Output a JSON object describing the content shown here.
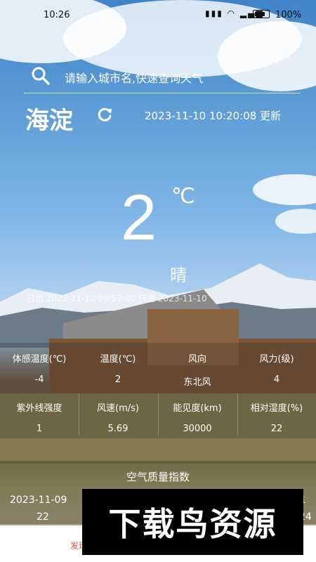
{
  "status_bar": {
    "time": "10:26",
    "battery_percent": "100%",
    "network": "4G"
  },
  "search": {
    "placeholder": "请输入城市名,快速查询天气"
  },
  "location": {
    "city": "海淀",
    "updated": "2023-11-10 10:20:08 更新"
  },
  "current": {
    "temperature": "2",
    "unit": "℃",
    "condition": "晴"
  },
  "sun": {
    "text": "日出 2023-11-10 06:57:00   日落 2023-11-10"
  },
  "details_row1": [
    {
      "label": "体感温度(℃)",
      "value": "-4"
    },
    {
      "label": "温度(℃)",
      "value": "2"
    },
    {
      "label": "风向",
      "value": "东北风"
    },
    {
      "label": "风力(级)",
      "value": "4"
    }
  ],
  "details_row2": [
    {
      "label": "紫外线强度",
      "value": "1"
    },
    {
      "label": "风速(m/s)",
      "value": "5.69"
    },
    {
      "label": "能见度(km)",
      "value": "30000"
    },
    {
      "label": "相对湿度(%)",
      "value": "22"
    }
  ],
  "air_quality": {
    "title": "空气质量指数",
    "first": {
      "date": "2023-11-09",
      "value": "22"
    },
    "last": {
      "date": "-1",
      "value": "24"
    }
  },
  "bottom_nav": {
    "tab_label": "发现"
  },
  "watermark": {
    "text": "下载鸟资源"
  },
  "colors": {
    "text": "#ffffff",
    "accent_tab": "#e05050"
  }
}
